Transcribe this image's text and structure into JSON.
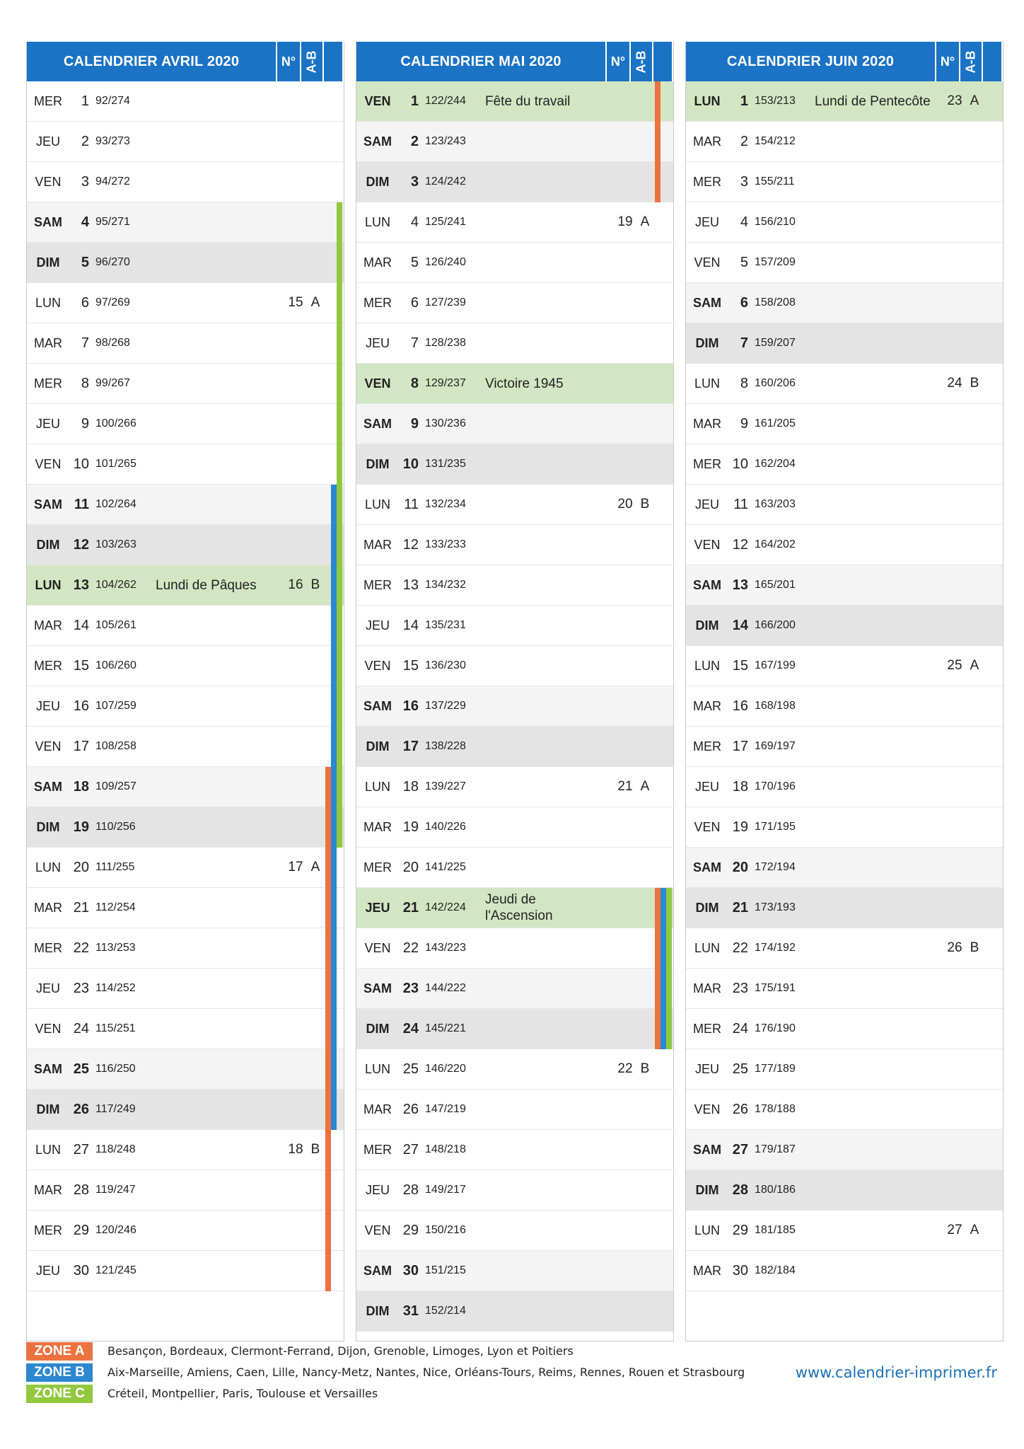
{
  "months": [
    {
      "title": "CALENDRIER AVRIL 2020",
      "no_label": "N°",
      "ab_label": "A-B",
      "days": [
        {
          "dn": "MER",
          "d": "1",
          "n": "92/274"
        },
        {
          "dn": "JEU",
          "d": "2",
          "n": "93/273"
        },
        {
          "dn": "VEN",
          "d": "3",
          "n": "94/272"
        },
        {
          "dn": "SAM",
          "d": "4",
          "n": "95/271",
          "t": "sat",
          "z": [
            "C"
          ]
        },
        {
          "dn": "DIM",
          "d": "5",
          "n": "96/270",
          "t": "sun",
          "z": [
            "C"
          ]
        },
        {
          "dn": "LUN",
          "d": "6",
          "n": "97/269",
          "w": "15",
          "ab": "A",
          "z": [
            "C"
          ]
        },
        {
          "dn": "MAR",
          "d": "7",
          "n": "98/268",
          "z": [
            "C"
          ]
        },
        {
          "dn": "MER",
          "d": "8",
          "n": "99/267",
          "z": [
            "C"
          ]
        },
        {
          "dn": "JEU",
          "d": "9",
          "n": "100/266",
          "z": [
            "C"
          ]
        },
        {
          "dn": "VEN",
          "d": "10",
          "n": "101/265",
          "z": [
            "C"
          ]
        },
        {
          "dn": "SAM",
          "d": "11",
          "n": "102/264",
          "t": "sat",
          "z": [
            "B",
            "C"
          ]
        },
        {
          "dn": "DIM",
          "d": "12",
          "n": "103/263",
          "t": "sun",
          "z": [
            "B",
            "C"
          ]
        },
        {
          "dn": "LUN",
          "d": "13",
          "n": "104/262",
          "t": "hol",
          "h": "Lundi de Pâques",
          "w": "16",
          "ab": "B",
          "z": [
            "B",
            "C"
          ]
        },
        {
          "dn": "MAR",
          "d": "14",
          "n": "105/261",
          "z": [
            "B",
            "C"
          ]
        },
        {
          "dn": "MER",
          "d": "15",
          "n": "106/260",
          "z": [
            "B",
            "C"
          ]
        },
        {
          "dn": "JEU",
          "d": "16",
          "n": "107/259",
          "z": [
            "B",
            "C"
          ]
        },
        {
          "dn": "VEN",
          "d": "17",
          "n": "108/258",
          "z": [
            "B",
            "C"
          ]
        },
        {
          "dn": "SAM",
          "d": "18",
          "n": "109/257",
          "t": "sat",
          "z": [
            "A",
            "B",
            "C"
          ]
        },
        {
          "dn": "DIM",
          "d": "19",
          "n": "110/256",
          "t": "sun",
          "z": [
            "A",
            "B",
            "C"
          ]
        },
        {
          "dn": "LUN",
          "d": "20",
          "n": "111/255",
          "w": "17",
          "ab": "A",
          "z": [
            "A",
            "B"
          ]
        },
        {
          "dn": "MAR",
          "d": "21",
          "n": "112/254",
          "z": [
            "A",
            "B"
          ]
        },
        {
          "dn": "MER",
          "d": "22",
          "n": "113/253",
          "z": [
            "A",
            "B"
          ]
        },
        {
          "dn": "JEU",
          "d": "23",
          "n": "114/252",
          "z": [
            "A",
            "B"
          ]
        },
        {
          "dn": "VEN",
          "d": "24",
          "n": "115/251",
          "z": [
            "A",
            "B"
          ]
        },
        {
          "dn": "SAM",
          "d": "25",
          "n": "116/250",
          "t": "sat",
          "z": [
            "A",
            "B"
          ]
        },
        {
          "dn": "DIM",
          "d": "26",
          "n": "117/249",
          "t": "sun",
          "z": [
            "A",
            "B"
          ]
        },
        {
          "dn": "LUN",
          "d": "27",
          "n": "118/248",
          "w": "18",
          "ab": "B",
          "z": [
            "A"
          ]
        },
        {
          "dn": "MAR",
          "d": "28",
          "n": "119/247",
          "z": [
            "A"
          ]
        },
        {
          "dn": "MER",
          "d": "29",
          "n": "120/246",
          "z": [
            "A"
          ]
        },
        {
          "dn": "JEU",
          "d": "30",
          "n": "121/245",
          "z": [
            "A"
          ]
        }
      ]
    },
    {
      "title": "CALENDRIER MAI 2020",
      "no_label": "N°",
      "ab_label": "A-B",
      "days": [
        {
          "dn": "VEN",
          "d": "1",
          "n": "122/244",
          "t": "hol",
          "h": "Fête du travail",
          "z": [
            "A"
          ]
        },
        {
          "dn": "SAM",
          "d": "2",
          "n": "123/243",
          "t": "sat",
          "z": [
            "A"
          ]
        },
        {
          "dn": "DIM",
          "d": "3",
          "n": "124/242",
          "t": "sun",
          "z": [
            "A"
          ]
        },
        {
          "dn": "LUN",
          "d": "4",
          "n": "125/241",
          "w": "19",
          "ab": "A"
        },
        {
          "dn": "MAR",
          "d": "5",
          "n": "126/240"
        },
        {
          "dn": "MER",
          "d": "6",
          "n": "127/239"
        },
        {
          "dn": "JEU",
          "d": "7",
          "n": "128/238"
        },
        {
          "dn": "VEN",
          "d": "8",
          "n": "129/237",
          "t": "hol",
          "h": "Victoire 1945"
        },
        {
          "dn": "SAM",
          "d": "9",
          "n": "130/236",
          "t": "sat"
        },
        {
          "dn": "DIM",
          "d": "10",
          "n": "131/235",
          "t": "sun"
        },
        {
          "dn": "LUN",
          "d": "11",
          "n": "132/234",
          "w": "20",
          "ab": "B"
        },
        {
          "dn": "MAR",
          "d": "12",
          "n": "133/233"
        },
        {
          "dn": "MER",
          "d": "13",
          "n": "134/232"
        },
        {
          "dn": "JEU",
          "d": "14",
          "n": "135/231"
        },
        {
          "dn": "VEN",
          "d": "15",
          "n": "136/230"
        },
        {
          "dn": "SAM",
          "d": "16",
          "n": "137/229",
          "t": "sat"
        },
        {
          "dn": "DIM",
          "d": "17",
          "n": "138/228",
          "t": "sun"
        },
        {
          "dn": "LUN",
          "d": "18",
          "n": "139/227",
          "w": "21",
          "ab": "A"
        },
        {
          "dn": "MAR",
          "d": "19",
          "n": "140/226"
        },
        {
          "dn": "MER",
          "d": "20",
          "n": "141/225"
        },
        {
          "dn": "JEU",
          "d": "21",
          "n": "142/224",
          "t": "hol",
          "h": "Jeudi de l'Ascension",
          "z": [
            "A",
            "B",
            "C"
          ]
        },
        {
          "dn": "VEN",
          "d": "22",
          "n": "143/223",
          "z": [
            "A",
            "B",
            "C"
          ]
        },
        {
          "dn": "SAM",
          "d": "23",
          "n": "144/222",
          "t": "sat",
          "z": [
            "A",
            "B",
            "C"
          ]
        },
        {
          "dn": "DIM",
          "d": "24",
          "n": "145/221",
          "t": "sun",
          "z": [
            "A",
            "B",
            "C"
          ]
        },
        {
          "dn": "LUN",
          "d": "25",
          "n": "146/220",
          "w": "22",
          "ab": "B"
        },
        {
          "dn": "MAR",
          "d": "26",
          "n": "147/219"
        },
        {
          "dn": "MER",
          "d": "27",
          "n": "148/218"
        },
        {
          "dn": "JEU",
          "d": "28",
          "n": "149/217"
        },
        {
          "dn": "VEN",
          "d": "29",
          "n": "150/216"
        },
        {
          "dn": "SAM",
          "d": "30",
          "n": "151/215",
          "t": "sat"
        },
        {
          "dn": "DIM",
          "d": "31",
          "n": "152/214",
          "t": "sun"
        }
      ]
    },
    {
      "title": "CALENDRIER JUIN 2020",
      "no_label": "N°",
      "ab_label": "A-B",
      "days": [
        {
          "dn": "LUN",
          "d": "1",
          "n": "153/213",
          "t": "hol",
          "h": "Lundi de Pentecôte",
          "w": "23",
          "ab": "A"
        },
        {
          "dn": "MAR",
          "d": "2",
          "n": "154/212"
        },
        {
          "dn": "MER",
          "d": "3",
          "n": "155/211"
        },
        {
          "dn": "JEU",
          "d": "4",
          "n": "156/210"
        },
        {
          "dn": "VEN",
          "d": "5",
          "n": "157/209"
        },
        {
          "dn": "SAM",
          "d": "6",
          "n": "158/208",
          "t": "sat"
        },
        {
          "dn": "DIM",
          "d": "7",
          "n": "159/207",
          "t": "sun"
        },
        {
          "dn": "LUN",
          "d": "8",
          "n": "160/206",
          "w": "24",
          "ab": "B"
        },
        {
          "dn": "MAR",
          "d": "9",
          "n": "161/205"
        },
        {
          "dn": "MER",
          "d": "10",
          "n": "162/204"
        },
        {
          "dn": "JEU",
          "d": "11",
          "n": "163/203"
        },
        {
          "dn": "VEN",
          "d": "12",
          "n": "164/202"
        },
        {
          "dn": "SAM",
          "d": "13",
          "n": "165/201",
          "t": "sat"
        },
        {
          "dn": "DIM",
          "d": "14",
          "n": "166/200",
          "t": "sun"
        },
        {
          "dn": "LUN",
          "d": "15",
          "n": "167/199",
          "w": "25",
          "ab": "A"
        },
        {
          "dn": "MAR",
          "d": "16",
          "n": "168/198"
        },
        {
          "dn": "MER",
          "d": "17",
          "n": "169/197"
        },
        {
          "dn": "JEU",
          "d": "18",
          "n": "170/196"
        },
        {
          "dn": "VEN",
          "d": "19",
          "n": "171/195"
        },
        {
          "dn": "SAM",
          "d": "20",
          "n": "172/194",
          "t": "sat"
        },
        {
          "dn": "DIM",
          "d": "21",
          "n": "173/193",
          "t": "sun"
        },
        {
          "dn": "LUN",
          "d": "22",
          "n": "174/192",
          "w": "26",
          "ab": "B"
        },
        {
          "dn": "MAR",
          "d": "23",
          "n": "175/191"
        },
        {
          "dn": "MER",
          "d": "24",
          "n": "176/190"
        },
        {
          "dn": "JEU",
          "d": "25",
          "n": "177/189"
        },
        {
          "dn": "VEN",
          "d": "26",
          "n": "178/188"
        },
        {
          "dn": "SAM",
          "d": "27",
          "n": "179/187",
          "t": "sat"
        },
        {
          "dn": "DIM",
          "d": "28",
          "n": "180/186",
          "t": "sun"
        },
        {
          "dn": "LUN",
          "d": "29",
          "n": "181/185",
          "w": "27",
          "ab": "A"
        },
        {
          "dn": "MAR",
          "d": "30",
          "n": "182/184"
        }
      ]
    }
  ],
  "zone_colors": {
    "A": "#ec7341",
    "B": "#2b87cf",
    "C": "#92c83e"
  },
  "legend": [
    {
      "label": "ZONE A",
      "zone": "A",
      "text": "Besançon, Bordeaux, Clermont-Ferrand, Dijon, Grenoble, Limoges, Lyon et Poitiers"
    },
    {
      "label": "ZONE B",
      "zone": "B",
      "text": "Aix-Marseille, Amiens, Caen, Lille, Nancy-Metz, Nantes, Nice, Orléans-Tours, Reims, Rennes, Rouen et Strasbourg"
    },
    {
      "label": "ZONE C",
      "zone": "C",
      "text": "Créteil, Montpellier, Paris, Toulouse et Versailles"
    }
  ],
  "website": "www.calendrier-imprimer.fr"
}
